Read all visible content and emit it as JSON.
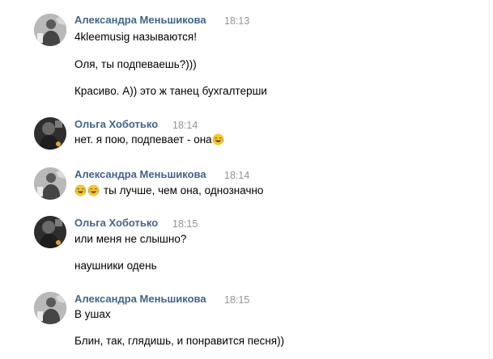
{
  "messages": [
    {
      "author": "Александра Меньшикова",
      "time": "18:13",
      "avatar_icon": "user-photo-avatar-a",
      "lines": [
        "4kleemusig называются!",
        "Оля, ты подпеваешь?)))",
        "Красиво. А)) это ж танец бухгалтерши"
      ]
    },
    {
      "author": "Ольга Хоботько",
      "time": "18:14",
      "avatar_icon": "user-photo-avatar-b",
      "lines": [
        "нет. я пою, подпевает - она"
      ],
      "emoji_after": "face-with-tears-of-joy-emoji"
    },
    {
      "author": "Александра Меньшикова",
      "time": "18:14",
      "avatar_icon": "user-photo-avatar-a",
      "lines": [
        "ты лучше, чем она, однозначно"
      ],
      "emoji_before": [
        "face-with-tears-of-joy-emoji",
        "face-with-tears-of-joy-emoji"
      ]
    },
    {
      "author": "Ольга Хоботько",
      "time": "18:15",
      "avatar_icon": "user-photo-avatar-b",
      "lines": [
        "или меня не слышно?",
        "наушники одень"
      ]
    },
    {
      "author": "Александра Меньшикова",
      "time": "18:15",
      "avatar_icon": "user-photo-avatar-a",
      "lines": [
        "В ушах",
        "Блин, так, глядишь, и понравится песня))"
      ]
    }
  ]
}
